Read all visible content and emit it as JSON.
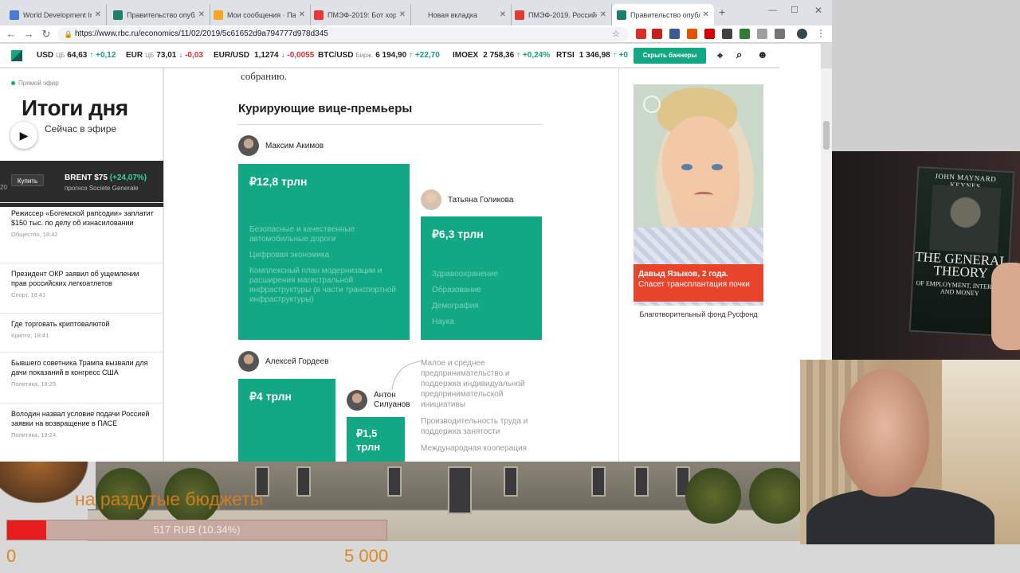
{
  "browser": {
    "tabs": [
      {
        "title": "World Development Ind",
        "fav_color": "#4a7bd6",
        "active": false
      },
      {
        "title": "Правительство опубл",
        "fav_color": "#1b7f6a",
        "active": false
      },
      {
        "title": "Мои сообщения · Па",
        "fav_color": "#f5a623",
        "active": false
      },
      {
        "title": "ПМЭФ-2019: Бот хорс",
        "fav_color": "#e53935",
        "active": false
      },
      {
        "title": "Новая вкладка",
        "fav_color": "",
        "active": false
      },
      {
        "title": "ПМЭФ-2019. Российс",
        "fav_color": "#e53935",
        "active": false
      },
      {
        "title": "Правительство опубл",
        "fav_color": "#1b7f6a",
        "active": true
      }
    ],
    "new_tab_symbol": "+",
    "url": "https://www.rbc.ru/economics/11/02/2019/5c61652d9a794777d978d345"
  },
  "ticker": {
    "items": [
      {
        "name": "USD",
        "label": "ЦБ",
        "value": "64,63",
        "change": "↑ +0,12",
        "dir": "up"
      },
      {
        "name": "EUR",
        "label": "ЦБ",
        "value": "73,01",
        "change": "↓ -0,03",
        "dir": "down"
      },
      {
        "name": "EUR/USD",
        "label": "",
        "value": "1,1274",
        "change": "↓ -0,0055",
        "dir": "down"
      },
      {
        "name": "BTC/USD",
        "label": "Бирж.",
        "value": "6 194,90",
        "change": "↑ +22,70",
        "dir": "up"
      },
      {
        "name": "IMOEX",
        "label": "",
        "value": "2 758,36",
        "change": "↑ +0,24%",
        "dir": "up"
      },
      {
        "name": "RTSI",
        "label": "",
        "value": "1 346,98",
        "change": "↑ +0",
        "dir": "up"
      }
    ],
    "hide_banners_label": "Скрыть баннеры"
  },
  "left": {
    "live_label": "Прямой эфир",
    "live_title": "Итоги дня",
    "live_sub": "Сейчас в эфире",
    "buy_label": "Купить",
    "brent_left": "20",
    "brent_value": "BRENT $75",
    "brent_change": "(+24,07%)",
    "brent_sub": "прогноз Societe Generale",
    "news": [
      {
        "title": "Режиссер «Богемской рапсодии» заплатит $150 тыс. по делу об изнасиловании",
        "meta": "Общество, 18:42"
      },
      {
        "title": "Президент ОКР заявил об ущемлении прав российских легкоатлетов",
        "meta": "Спорт, 18:41"
      },
      {
        "title": "Где торговать криптовалютой",
        "meta": "Крипто, 18:41"
      },
      {
        "title": "Бывшего советника Трампа вызвали для дачи показаний в конгресс США",
        "meta": "Политика, 18:25"
      },
      {
        "title": "Володин назвал условие подачи Россией заявки на возвращение в ПАСЕ",
        "meta": "Политика, 18:24"
      }
    ]
  },
  "article": {
    "top_text": "собранию.",
    "section_title": "Курирующие вице-премьеры",
    "persons": [
      {
        "name": "Максим Акимов",
        "amount": "₽12,8 трлн",
        "items": [
          "Безопасные и качественные автомобильные дороги",
          "Цифровая экономика",
          "Комплексный план модернизации и расширения магистральной инфраструктуры (в части транспортной инфраструктуры)"
        ]
      },
      {
        "name": "Татьяна Голикова",
        "amount": "₽6,3 трлн",
        "items": [
          "Здравоохранение",
          "Образование",
          "Демография",
          "Наука"
        ]
      },
      {
        "name": "Алексей Гордеев",
        "amount": "₽4 трлн",
        "items": []
      },
      {
        "name": "Антон Силуанов",
        "amount": "₽1,5 трлн",
        "items": []
      }
    ],
    "siluanov_items": [
      "Малое и среднее предпринимательство и поддержка индивидуальной предпринимательской инициативы",
      "Производительность труда и поддержка занятости",
      "Международная кооперация"
    ]
  },
  "ad": {
    "caption_name": "Давыд Языков, 2 года.",
    "caption_need": "Спасет трансплантация почки",
    "fund": "Благотворительный фонд Русфонд"
  },
  "overlay": {
    "caption": "на раздутые бюджеты",
    "progress_label": "517 RUB (10.34%)",
    "progress_fraction": 0.1034,
    "min": "0",
    "max": "5 000"
  },
  "book": {
    "author": "JOHN MAYNARD KEYNES",
    "title": "THE GENERAL THEORY",
    "subtitle": "OF EMPLOYMENT, INTEREST, AND MONEY"
  }
}
